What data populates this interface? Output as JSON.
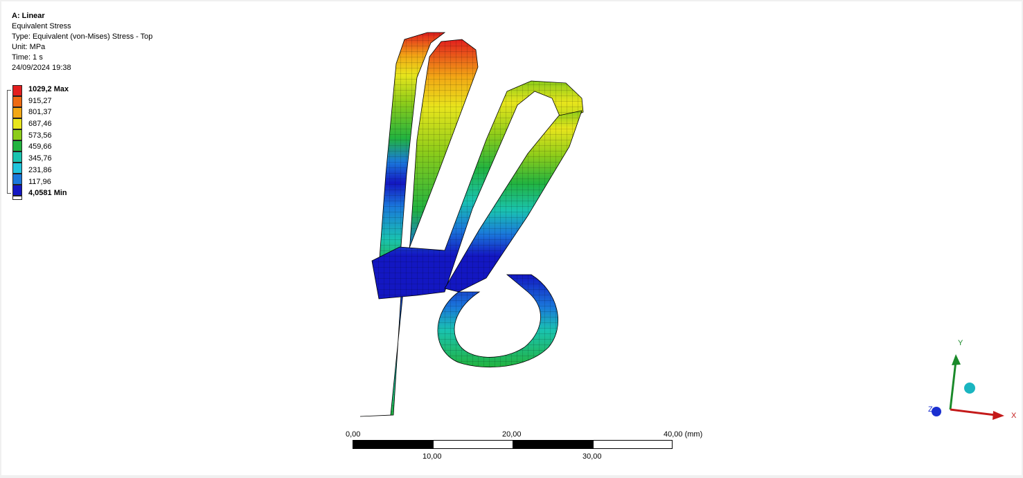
{
  "result": {
    "title": "A: Linear",
    "name": "Equivalent Stress",
    "type": "Type: Equivalent (von-Mises) Stress - Top",
    "unit": "Unit: MPa",
    "time": "Time: 1 s",
    "date": "24/09/2024 19:38"
  },
  "legend": {
    "levels": [
      {
        "label": "1029,2 Max",
        "color": "#e21e1e",
        "bold": true
      },
      {
        "label": "915,27",
        "color": "#ee6a12",
        "bold": false
      },
      {
        "label": "801,37",
        "color": "#f2a715",
        "bold": false
      },
      {
        "label": "687,46",
        "color": "#e8e51c",
        "bold": false
      },
      {
        "label": "573,56",
        "color": "#8ccc1a",
        "bold": false
      },
      {
        "label": "459,66",
        "color": "#22b33f",
        "bold": false
      },
      {
        "label": "345,76",
        "color": "#1ac3b0",
        "bold": false
      },
      {
        "label": "231,86",
        "color": "#20c4dc",
        "bold": false
      },
      {
        "label": "117,96",
        "color": "#1a78db",
        "bold": false
      },
      {
        "label": "4,0581 Min",
        "color": "#1317c2",
        "bold": true
      }
    ]
  },
  "scale_bar": {
    "top_labels": [
      "0,00",
      "20,00",
      "40,00 (mm)"
    ],
    "bottom_labels": [
      "10,00",
      "30,00"
    ]
  },
  "triad": {
    "x_label": "X",
    "y_label": "Y",
    "z_label": "Z",
    "x_color": "#c41a1a",
    "y_color": "#1a8a2a",
    "z_color": "#1a2fd0",
    "iso_color": "#1ab5c0"
  }
}
